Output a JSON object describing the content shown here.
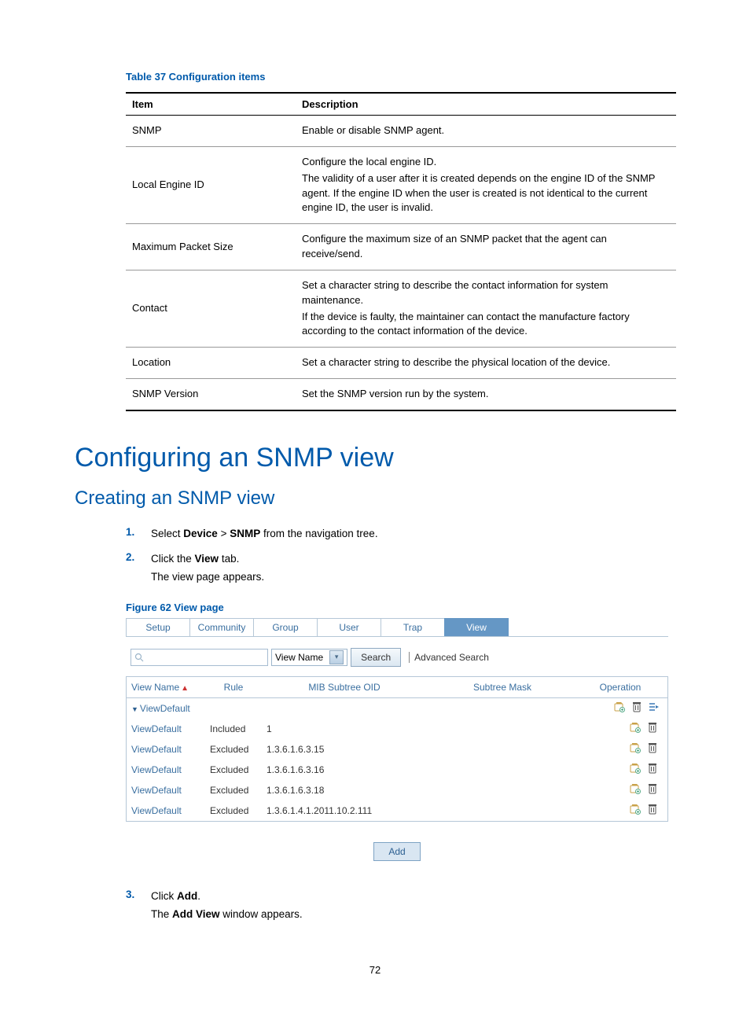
{
  "table_caption": "Table 37 Configuration items",
  "config_table": {
    "head": {
      "item": "Item",
      "desc": "Description"
    },
    "rows": [
      {
        "item": "SNMP",
        "desc": "Enable or disable SNMP agent."
      },
      {
        "item": "Local Engine ID",
        "desc": "Configure the local engine ID.\nThe validity of a user after it is created depends on the engine ID of the SNMP agent. If the engine ID when the user is created is not identical to the current engine ID, the user is invalid."
      },
      {
        "item": "Maximum Packet Size",
        "desc": "Configure the maximum size of an SNMP packet that the agent can receive/send."
      },
      {
        "item": "Contact",
        "desc": "Set a character string to describe the contact information for system maintenance.\nIf the device is faulty, the maintainer can contact the manufacture factory according to the contact information of the device."
      },
      {
        "item": "Location",
        "desc": "Set a character string to describe the physical location of the device."
      },
      {
        "item": "SNMP Version",
        "desc": "Set the SNMP version run by the system."
      }
    ]
  },
  "heading_main": "Configuring an SNMP view",
  "heading_sub": "Creating an SNMP view",
  "steps": [
    {
      "num": "1.",
      "parts": [
        "Select ",
        "Device",
        " > ",
        "SNMP",
        " from the navigation tree."
      ]
    },
    {
      "num": "2.",
      "parts": [
        "Click the ",
        "View",
        " tab."
      ],
      "after": "The view page appears."
    },
    {
      "num": "3.",
      "parts": [
        "Click ",
        "Add",
        "."
      ],
      "after_parts": [
        "The ",
        "Add View",
        " window appears."
      ]
    }
  ],
  "figure_caption": "Figure 62 View page",
  "snmp": {
    "tabs": [
      "Setup",
      "Community",
      "Group",
      "User",
      "Trap",
      "View"
    ],
    "active_tab": "View",
    "search": {
      "select_label": "View Name",
      "search_btn": "Search",
      "advanced": "Advanced Search"
    },
    "columns": {
      "view": "View Name",
      "rule": "Rule",
      "oid": "MIB Subtree OID",
      "mask": "Subtree Mask",
      "op": "Operation"
    },
    "group_label": "ViewDefault",
    "rows": [
      {
        "view": "ViewDefault",
        "rule": "Included",
        "oid": "1",
        "mask": ""
      },
      {
        "view": "ViewDefault",
        "rule": "Excluded",
        "oid": "1.3.6.1.6.3.15",
        "mask": ""
      },
      {
        "view": "ViewDefault",
        "rule": "Excluded",
        "oid": "1.3.6.1.6.3.16",
        "mask": ""
      },
      {
        "view": "ViewDefault",
        "rule": "Excluded",
        "oid": "1.3.6.1.6.3.18",
        "mask": ""
      },
      {
        "view": "ViewDefault",
        "rule": "Excluded",
        "oid": "1.3.6.1.4.1.2011.10.2.111",
        "mask": ""
      }
    ],
    "add_btn": "Add"
  },
  "page_number": "72",
  "chart_data": {
    "type": "table",
    "title": "SNMP View page table",
    "columns": [
      "View Name",
      "Rule",
      "MIB Subtree OID",
      "Subtree Mask"
    ],
    "rows": [
      [
        "ViewDefault",
        "Included",
        "1",
        ""
      ],
      [
        "ViewDefault",
        "Excluded",
        "1.3.6.1.6.3.15",
        ""
      ],
      [
        "ViewDefault",
        "Excluded",
        "1.3.6.1.6.3.16",
        ""
      ],
      [
        "ViewDefault",
        "Excluded",
        "1.3.6.1.6.3.18",
        ""
      ],
      [
        "ViewDefault",
        "Excluded",
        "1.3.6.1.4.1.2011.10.2.111",
        ""
      ]
    ]
  }
}
